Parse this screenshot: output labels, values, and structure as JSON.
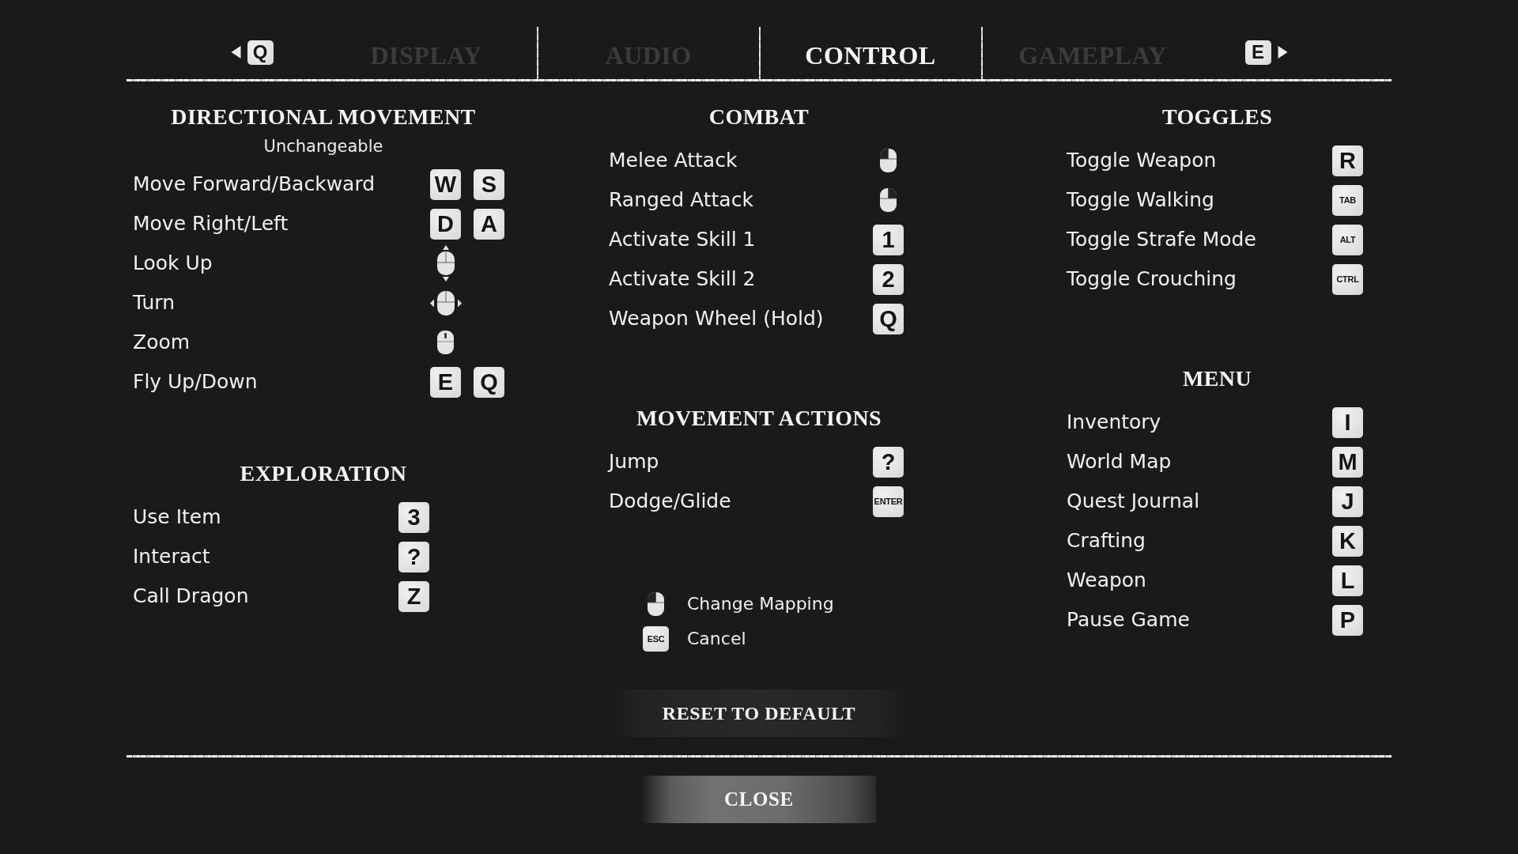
{
  "tab_bar": {
    "prev_key": "Q",
    "next_key": "E",
    "tabs": [
      {
        "label": "DISPLAY",
        "selected": false
      },
      {
        "label": "AUDIO",
        "selected": false
      },
      {
        "label": "CONTROL",
        "selected": true
      },
      {
        "label": "GAMEPLAY",
        "selected": false
      }
    ]
  },
  "columns": [
    {
      "sections": [
        {
          "title": "DIRECTIONAL MOVEMENT",
          "subtitle": "Unchangeable",
          "bindings": [
            {
              "action": "Move Forward/Backward",
              "inputs": [
                {
                  "kind": "key",
                  "label": "W"
                },
                {
                  "kind": "key",
                  "label": "S"
                }
              ]
            },
            {
              "action": "Move Right/Left",
              "inputs": [
                {
                  "kind": "key",
                  "label": "D"
                },
                {
                  "kind": "key",
                  "label": "A"
                }
              ]
            },
            {
              "action": "Look Up",
              "inputs": [
                {
                  "kind": "vertical"
                }
              ]
            },
            {
              "action": "Turn",
              "inputs": [
                {
                  "kind": "horizontal"
                }
              ]
            },
            {
              "action": "Zoom",
              "inputs": [
                {
                  "kind": "scroll"
                }
              ]
            },
            {
              "action": "Fly Up/Down",
              "inputs": [
                {
                  "kind": "key",
                  "label": "E"
                },
                {
                  "kind": "key",
                  "label": "Q"
                }
              ]
            }
          ]
        },
        {
          "title": "EXPLORATION",
          "bindings": [
            {
              "action": "Use Item",
              "inputs": [
                {
                  "kind": "key",
                  "label": "3"
                }
              ]
            },
            {
              "action": "Interact",
              "inputs": [
                {
                  "kind": "key",
                  "label": "?"
                }
              ]
            },
            {
              "action": "Call Dragon",
              "inputs": [
                {
                  "kind": "key",
                  "label": "Z"
                }
              ]
            }
          ]
        }
      ]
    },
    {
      "sections": [
        {
          "title": "COMBAT",
          "bindings": [
            {
              "action": "Melee Attack",
              "inputs": [
                {
                  "kind": "leftclick"
                }
              ]
            },
            {
              "action": "Ranged Attack",
              "inputs": [
                {
                  "kind": "rightclick"
                }
              ]
            },
            {
              "action": "Activate Skill 1",
              "inputs": [
                {
                  "kind": "key",
                  "label": "1"
                }
              ]
            },
            {
              "action": "Activate Skill 2",
              "inputs": [
                {
                  "kind": "key",
                  "label": "2"
                }
              ]
            },
            {
              "action": "Weapon Wheel (Hold)",
              "inputs": [
                {
                  "kind": "key",
                  "label": "Q"
                }
              ]
            }
          ]
        },
        {
          "title": "MOVEMENT ACTIONS",
          "bindings": [
            {
              "action": "Jump",
              "inputs": [
                {
                  "kind": "key",
                  "label": "?"
                }
              ]
            },
            {
              "action": "Dodge/Glide",
              "inputs": [
                {
                  "kind": "namedkey",
                  "label": "ENTER"
                }
              ]
            }
          ]
        }
      ],
      "legend": [
        {
          "input": {
            "kind": "leftclick"
          },
          "label": "Change Mapping"
        },
        {
          "input": {
            "kind": "namedkey",
            "label": "ESC"
          },
          "label": "Cancel"
        }
      ],
      "reset_button": "RESET TO DEFAULT"
    },
    {
      "sections": [
        {
          "title": "TOGGLES",
          "bindings": [
            {
              "action": "Toggle Weapon",
              "inputs": [
                {
                  "kind": "key",
                  "label": "R"
                }
              ]
            },
            {
              "action": "Toggle Walking",
              "inputs": [
                {
                  "kind": "namedkey",
                  "label": "TAB"
                }
              ]
            },
            {
              "action": "Toggle Strafe Mode",
              "inputs": [
                {
                  "kind": "namedkey",
                  "label": "ALT"
                }
              ]
            },
            {
              "action": "Toggle Crouching",
              "inputs": [
                {
                  "kind": "namedkey",
                  "label": "CTRL"
                }
              ]
            }
          ]
        },
        {
          "title": "MENU",
          "bindings": [
            {
              "action": "Inventory",
              "inputs": [
                {
                  "kind": "key",
                  "label": "I"
                }
              ]
            },
            {
              "action": "World Map",
              "inputs": [
                {
                  "kind": "key",
                  "label": "M"
                }
              ]
            },
            {
              "action": "Quest Journal",
              "inputs": [
                {
                  "kind": "key",
                  "label": "J"
                }
              ]
            },
            {
              "action": "Crafting",
              "inputs": [
                {
                  "kind": "key",
                  "label": "K"
                }
              ]
            },
            {
              "action": "Weapon",
              "inputs": [
                {
                  "kind": "key",
                  "label": "L"
                }
              ]
            },
            {
              "action": "Pause Game",
              "inputs": [
                {
                  "kind": "key",
                  "label": "P"
                }
              ]
            }
          ]
        }
      ]
    }
  ],
  "close_button": "CLOSE"
}
